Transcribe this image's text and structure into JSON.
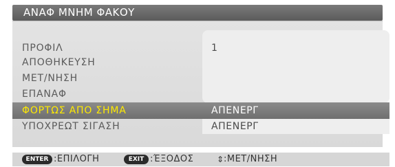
{
  "window": {
    "title": "ΑΝΑΦ ΜΝΗΜ ΦΑΚΟΥ"
  },
  "menu": {
    "items": [
      {
        "label": "ΠΡΟΦΙΛ",
        "value": "1",
        "selected": false
      },
      {
        "label": "ΑΠΟΘΗΚΕΥΣΗ",
        "value": "",
        "selected": false
      },
      {
        "label": "ΜΕΤ/ΝΗΣΗ",
        "value": "",
        "selected": false
      },
      {
        "label": "ΕΠΑΝΑΦ",
        "value": "",
        "selected": false
      },
      {
        "label": "ΦΟΡΤΩΣ ΑΠΟ ΣΗΜΑ",
        "value": "ΑΠΕΝΕΡΓ",
        "selected": true
      },
      {
        "label": "ΥΠΟΧΡΕΩΤ ΣΙΓΑΣΗ",
        "value": "ΑΠΕΝΕΡΓ",
        "selected": false
      }
    ]
  },
  "footer": {
    "enter_key": "ENTER",
    "enter_action": ":ΕΠΙΛΟΓΗ",
    "exit_key": "EXIT",
    "exit_action": ":ΈΞΟΔΟΣ",
    "move_action": ":ΜΕΤ/ΝΗΣΗ"
  },
  "colors": {
    "selected_label": "#ffea00",
    "highlight_bar": "#7b7b7b",
    "title_bar": "#666666"
  },
  "icons": {
    "move": "up-down-arrow-icon"
  }
}
